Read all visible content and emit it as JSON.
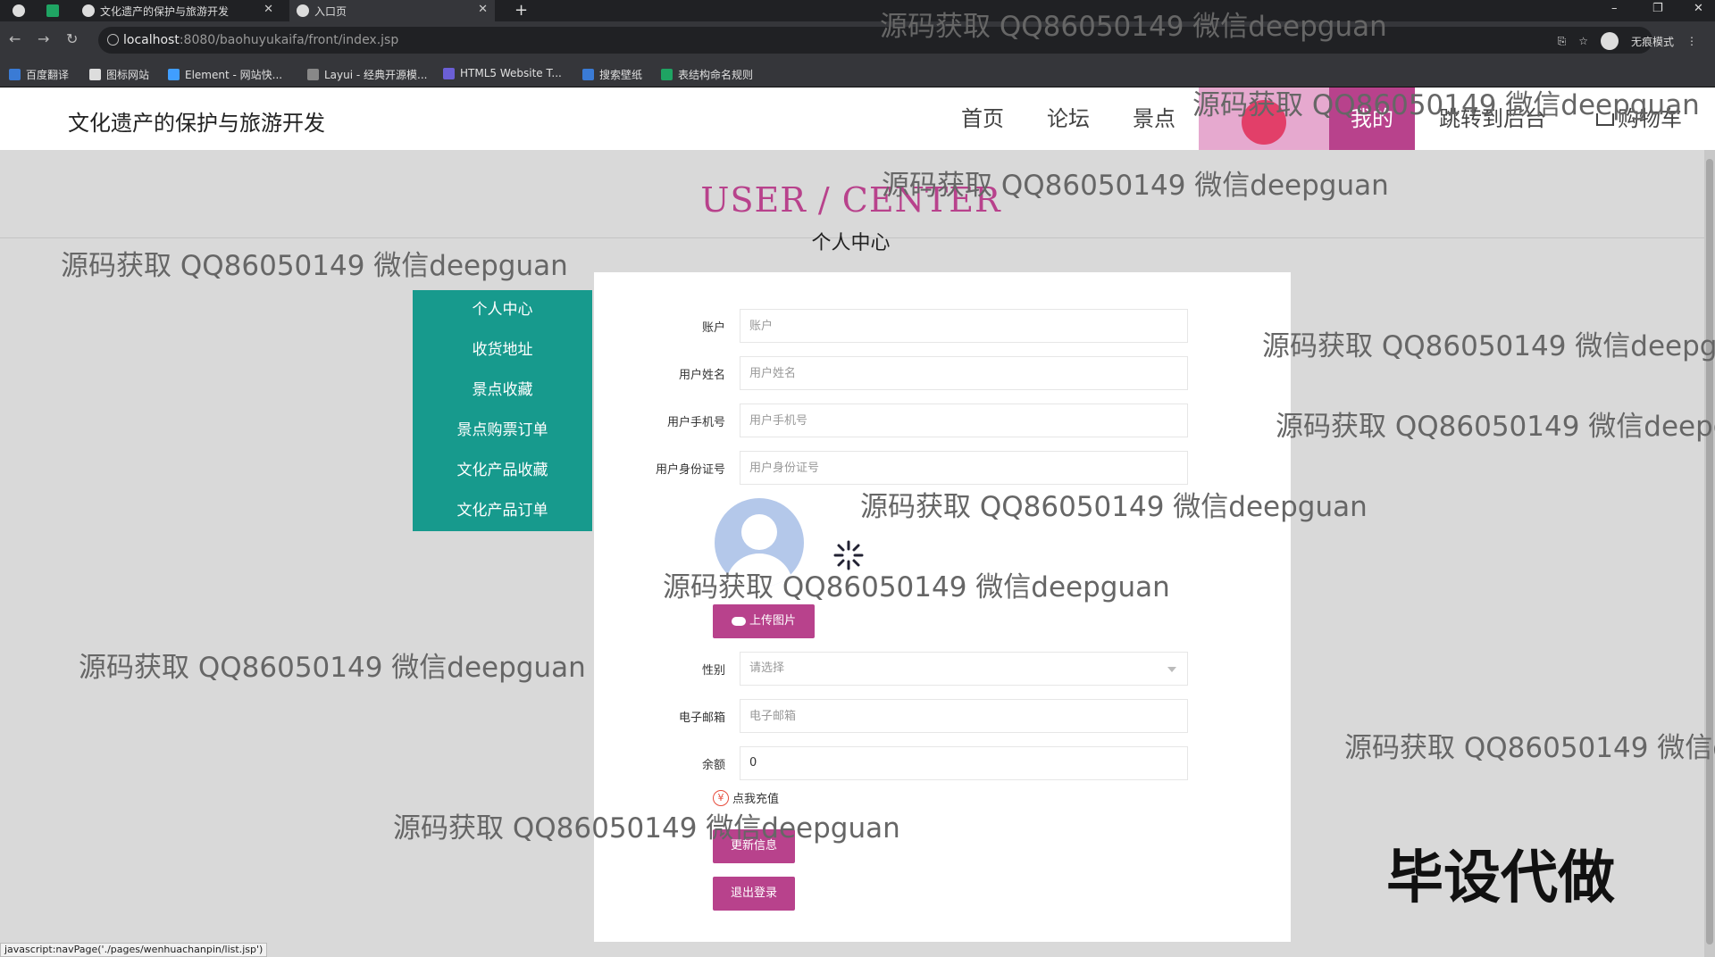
{
  "browser": {
    "tabs": [
      {
        "label": "文化遗产的保护与旅游开发"
      },
      {
        "label": "入口页"
      }
    ],
    "url_host": "localhost",
    "url_path": ":8080/baohuyukaifa/front/index.jsp",
    "profile_label": "无痕模式",
    "bookmarks": [
      "百度翻译",
      "图标网站",
      "Element - 网站快...",
      "Layui - 经典开源模...",
      "HTML5 Website T...",
      "搜索壁纸",
      "表结构命名规则"
    ],
    "status_bar": "javascript:navPage('./pages/wenhuachanpin/list.jsp')"
  },
  "header": {
    "site_title": "文化遗产的保护与旅游开发",
    "nav": [
      "首页",
      "论坛",
      "景点",
      "",
      "我的",
      "跳转到后台",
      "购物车"
    ]
  },
  "user_center": {
    "title": "USER / CENTER",
    "subtitle": "个人中心"
  },
  "menu": [
    "个人中心",
    "收货地址",
    "景点收藏",
    "景点购票订单",
    "文化产品收藏",
    "文化产品订单"
  ],
  "form": {
    "account": {
      "label": "账户",
      "placeholder": "账户"
    },
    "name": {
      "label": "用户姓名",
      "placeholder": "用户姓名"
    },
    "phone": {
      "label": "用户手机号",
      "placeholder": "用户手机号"
    },
    "idcard": {
      "label": "用户身份证号",
      "placeholder": "用户身份证号"
    },
    "upload_label": "上传图片",
    "gender": {
      "label": "性别",
      "selected": "请选择"
    },
    "email": {
      "label": "电子邮箱",
      "placeholder": "电子邮箱"
    },
    "balance": {
      "label": "余额",
      "value": "0"
    },
    "recharge_label": "点我充值",
    "update_label": "更新信息",
    "logout_label": "退出登录"
  },
  "watermark_text": "源码获取 QQ86050149 微信deepguan",
  "badge": "毕设代做",
  "colors": {
    "accent": "#b8428c",
    "menu_bg": "#179a8d"
  }
}
